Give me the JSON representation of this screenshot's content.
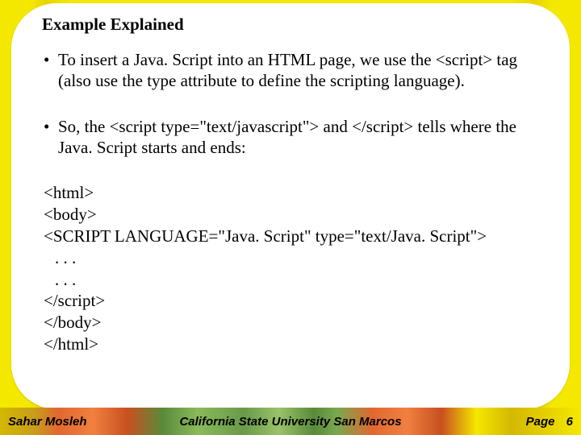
{
  "title": "Example Explained",
  "bullets": [
    "To insert a Java. Script into an HTML page, we use the <script> tag (also use the type attribute to define the scripting language).",
    "So, the <script type=\"text/javascript\"> and </script> tells where the Java. Script starts and ends:"
  ],
  "code": {
    "l1": "<html>",
    "l2": "<body>",
    "l3": "<SCRIPT LANGUAGE=\"Java. Script\"  type=\"text/Java. Script\">",
    "l4": ". . .",
    "l5": ". . .",
    "l6": "</script>",
    "l7": "</body>",
    "l8": "</html>"
  },
  "footer": {
    "left": "Sahar Mosleh",
    "center": "California State University San Marcos",
    "pageLabel": "Page",
    "pageNum": "6"
  }
}
